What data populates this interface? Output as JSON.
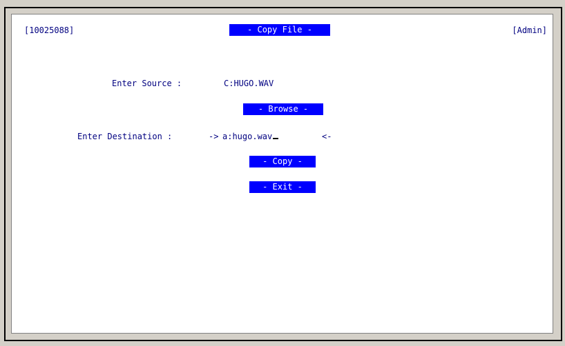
{
  "header": {
    "id_label": "[10025088]",
    "title": "- Copy File -",
    "user_label": "[Admin]"
  },
  "form": {
    "source_label": "Enter Source :",
    "source_value": "C:HUGO.WAV",
    "browse_label": "- Browse -",
    "destination_label": "Enter Destination :",
    "destination_prefix": "->",
    "destination_value": "a:hugo.wav",
    "destination_suffix": "<-",
    "copy_label": "- Copy -",
    "exit_label": "- Exit -"
  },
  "colors": {
    "accent": "#0000ff",
    "text": "#000080",
    "background": "#ffffff"
  }
}
